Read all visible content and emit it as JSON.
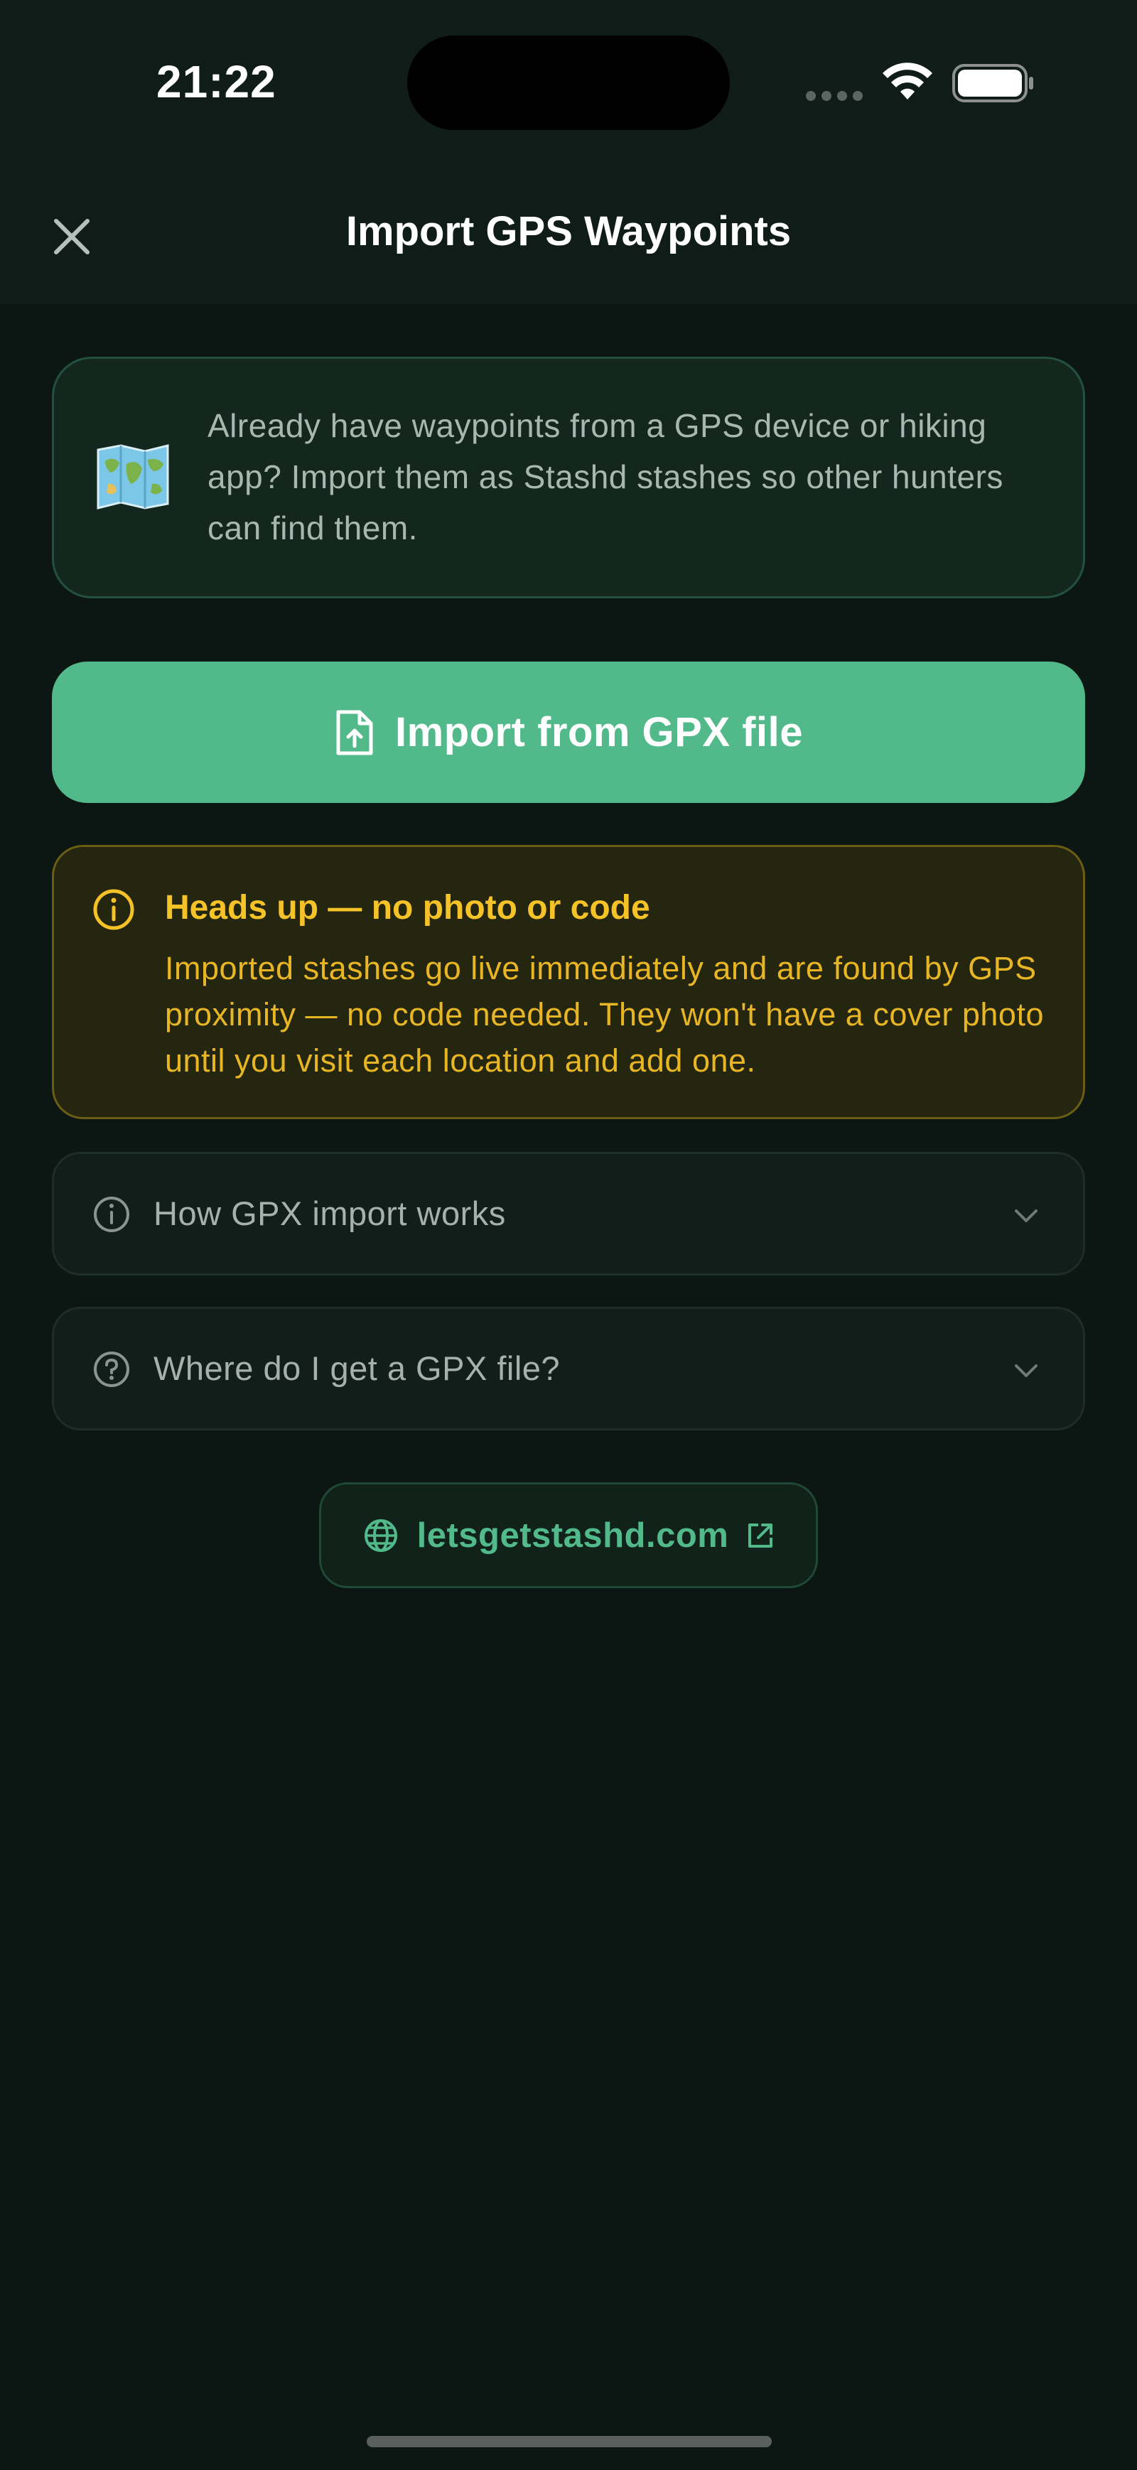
{
  "status_bar": {
    "time": "21:22"
  },
  "header": {
    "title": "Import GPS Waypoints"
  },
  "intro": {
    "text": "Already have waypoints from a GPS device or hiking app? Import them as Stashd stashes so other hunters can find them."
  },
  "import_button": {
    "label": "Import from GPX file"
  },
  "warning": {
    "title": "Heads up — no photo or code",
    "body": "Imported stashes go live immediately and are found by GPS proximity — no code needed. They won't have a cover photo until you visit each location and add one."
  },
  "accordions": [
    {
      "label": "How GPX import works",
      "icon": "info-circle-icon"
    },
    {
      "label": "Where do I get a GPX file?",
      "icon": "question-circle-icon"
    }
  ],
  "website": {
    "label": "letsgetstashd.com"
  },
  "colors": {
    "background": "#0c1612",
    "header": "#101c17",
    "accent": "#52b98a",
    "warning": "#f5c228",
    "warning_bg": "#25260f"
  }
}
